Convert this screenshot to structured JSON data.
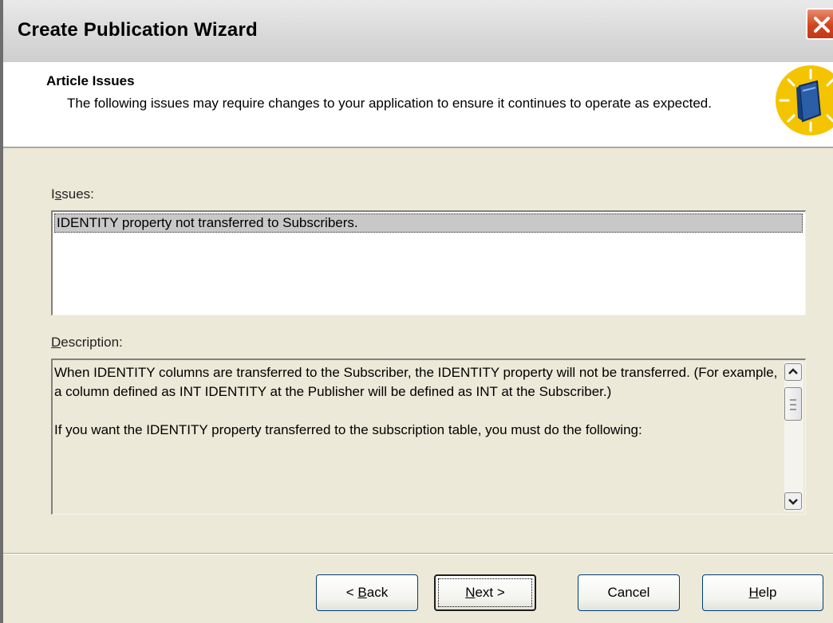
{
  "window": {
    "title": "Create Publication Wizard"
  },
  "header": {
    "title": "Article Issues",
    "description": "The following issues may require changes to your application to ensure it continues to operate as expected."
  },
  "issues": {
    "label_first": "I",
    "label_accel": "s",
    "label_rest": "sues:",
    "items": [
      "IDENTITY property not transferred to Subscribers."
    ]
  },
  "description": {
    "label_accel": "D",
    "label_rest": "escription:",
    "text": "When IDENTITY columns are transferred to the Subscriber, the IDENTITY property will not be transferred. (For example, a column defined as INT IDENTITY at the Publisher will be defined as INT at the Subscriber.)\n\nIf you want the IDENTITY property transferred to the subscription table, you must do the following:"
  },
  "buttons": {
    "back_prefix": "< ",
    "back_accel": "B",
    "back_rest": "ack",
    "next_accel": "N",
    "next_rest": "ext >",
    "cancel": "Cancel",
    "help_accel": "H",
    "help_rest": "elp"
  },
  "colors": {
    "dialog_bg": "#ece9d8",
    "selection_bg": "#c8c8c8",
    "close_red": "#d2451d",
    "icon_yellow": "#f5c400"
  }
}
